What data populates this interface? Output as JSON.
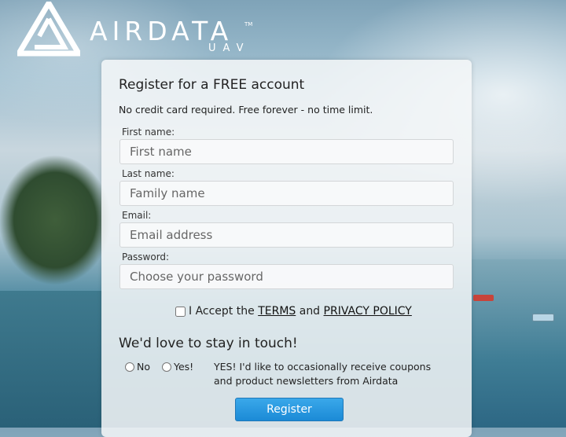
{
  "logo": {
    "word": "AIRDATA",
    "tm": "TM",
    "sub": "UAV"
  },
  "form": {
    "title": "Register for a FREE account",
    "subtitle": "No credit card required. Free forever - no time limit.",
    "fields": [
      {
        "label": "First name:",
        "placeholder": "First name"
      },
      {
        "label": "Last name:",
        "placeholder": "Family name"
      },
      {
        "label": "Email:",
        "placeholder": "Email address"
      },
      {
        "label": "Password:",
        "placeholder": "Choose your password"
      }
    ],
    "accept": {
      "prefix": "I Accept the",
      "terms": "TERMS",
      "and": "and",
      "privacy": "PRIVACY POLICY",
      "checked": false
    }
  },
  "touch": {
    "title": "We'd love to stay in touch!",
    "no_label": "No",
    "yes_label": "Yes!",
    "text": "YES! I'd like to occasionally receive coupons and product newsletters from Airdata"
  },
  "register_label": "Register",
  "colors": {
    "button": "#1b8ad6",
    "card": "#f5f7f8"
  }
}
